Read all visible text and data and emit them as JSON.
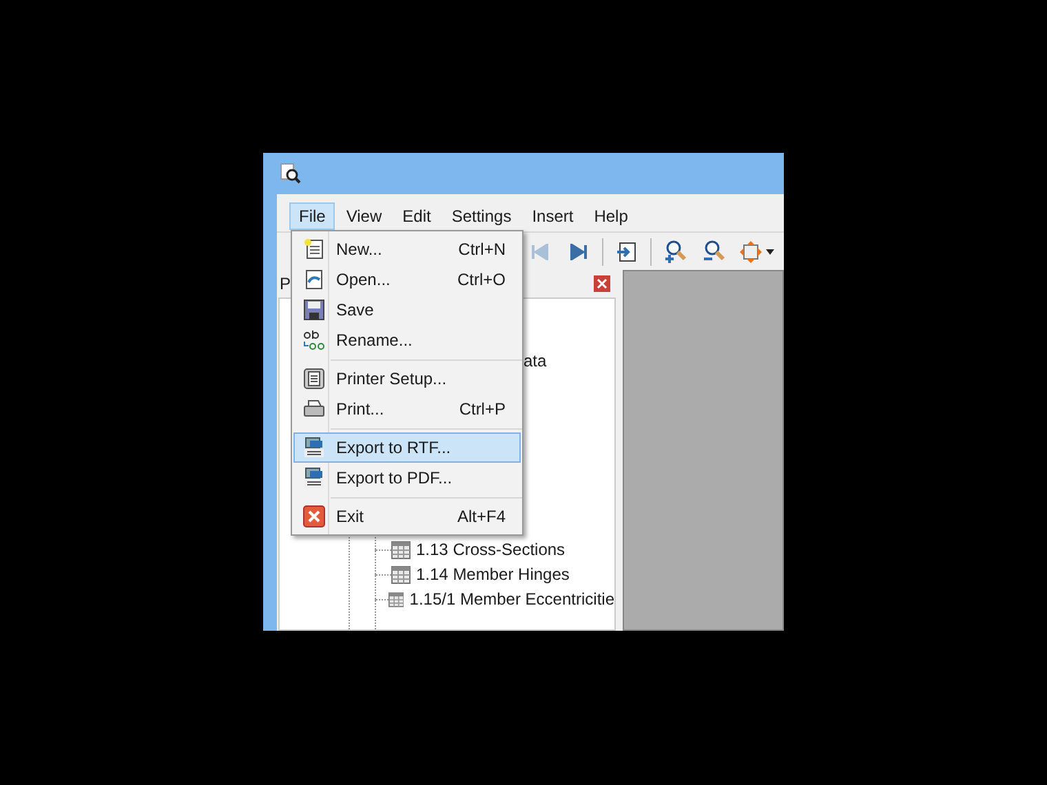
{
  "menu_bar": [
    {
      "label": "File",
      "selected": true
    },
    {
      "label": "View",
      "selected": false
    },
    {
      "label": "Edit",
      "selected": false
    },
    {
      "label": "Settings",
      "selected": false
    },
    {
      "label": "Insert",
      "selected": false
    },
    {
      "label": "Help",
      "selected": false
    }
  ],
  "toolbar": {
    "nav_buttons": [
      {
        "disabled": true
      },
      {
        "disabled": false
      }
    ]
  },
  "panel": {
    "title": "P",
    "tree_fragment": "ata",
    "rows": [
      "1.13 Cross-Sections",
      "1.14 Member Hinges",
      "1.15/1 Member Eccentricitie"
    ]
  },
  "file_menu": [
    {
      "kind": "item",
      "label": "New...",
      "shortcut": "Ctrl+N",
      "selected": false
    },
    {
      "kind": "item",
      "label": "Open...",
      "shortcut": "Ctrl+O",
      "selected": false
    },
    {
      "kind": "item",
      "label": "Save",
      "selected": false
    },
    {
      "kind": "item",
      "label": "Rename...",
      "selected": false
    },
    {
      "kind": "separator"
    },
    {
      "kind": "item",
      "label": "Printer Setup...",
      "selected": false
    },
    {
      "kind": "item",
      "label": "Print...",
      "shortcut": "Ctrl+P",
      "selected": false
    },
    {
      "kind": "separator"
    },
    {
      "kind": "item",
      "label": "Export to RTF...",
      "selected": true
    },
    {
      "kind": "item",
      "label": "Export to PDF...",
      "selected": false
    },
    {
      "kind": "separator"
    },
    {
      "kind": "item",
      "label": "Exit",
      "shortcut": "Alt+F4",
      "selected": false
    }
  ]
}
